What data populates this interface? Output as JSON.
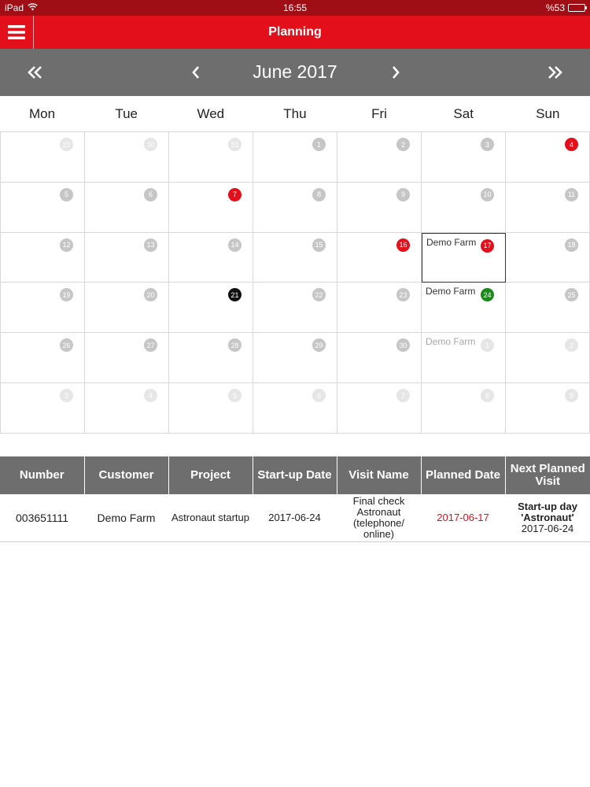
{
  "status_bar": {
    "device": "iPad",
    "time": "16:55",
    "battery": "%53",
    "battery_level": 0.53
  },
  "header": {
    "title": "Planning",
    "menu_icon": "hamburger-icon"
  },
  "calendar": {
    "month_title": "June 2017",
    "weekdays": [
      "Mon",
      "Tue",
      "Wed",
      "Thu",
      "Fri",
      "Sat",
      "Sun"
    ],
    "weeks": [
      [
        {
          "day": "29",
          "outside": true,
          "color": "grey"
        },
        {
          "day": "30",
          "outside": true,
          "color": "grey"
        },
        {
          "day": "31",
          "outside": true,
          "color": "grey"
        },
        {
          "day": "1",
          "color": "grey"
        },
        {
          "day": "2",
          "color": "grey"
        },
        {
          "day": "3",
          "color": "grey"
        },
        {
          "day": "4",
          "color": "red"
        }
      ],
      [
        {
          "day": "5",
          "color": "grey"
        },
        {
          "day": "6",
          "color": "grey"
        },
        {
          "day": "7",
          "color": "red"
        },
        {
          "day": "8",
          "color": "grey"
        },
        {
          "day": "9",
          "color": "grey"
        },
        {
          "day": "10",
          "color": "grey"
        },
        {
          "day": "11",
          "color": "grey"
        }
      ],
      [
        {
          "day": "12",
          "color": "grey"
        },
        {
          "day": "13",
          "color": "grey"
        },
        {
          "day": "14",
          "color": "grey"
        },
        {
          "day": "15",
          "color": "grey"
        },
        {
          "day": "16",
          "color": "red"
        },
        {
          "day": "17",
          "color": "red",
          "event": "Demo Farm",
          "selected": true
        },
        {
          "day": "18",
          "color": "grey"
        }
      ],
      [
        {
          "day": "19",
          "color": "grey"
        },
        {
          "day": "20",
          "color": "grey"
        },
        {
          "day": "21",
          "color": "black"
        },
        {
          "day": "22",
          "color": "grey"
        },
        {
          "day": "23",
          "color": "grey"
        },
        {
          "day": "24",
          "color": "green",
          "event": "Demo Farm"
        },
        {
          "day": "25",
          "color": "grey"
        }
      ],
      [
        {
          "day": "26",
          "color": "grey"
        },
        {
          "day": "27",
          "color": "grey"
        },
        {
          "day": "28",
          "color": "grey"
        },
        {
          "day": "29",
          "color": "grey"
        },
        {
          "day": "30",
          "color": "grey"
        },
        {
          "day": "1",
          "outside": true,
          "color": "lightgreen",
          "event": "Demo Farm",
          "faded": true
        },
        {
          "day": "2",
          "outside": true,
          "color": "grey"
        }
      ],
      [
        {
          "day": "3",
          "outside": true,
          "color": "grey"
        },
        {
          "day": "4",
          "outside": true,
          "color": "grey"
        },
        {
          "day": "5",
          "outside": true,
          "color": "grey"
        },
        {
          "day": "6",
          "outside": true,
          "color": "grey"
        },
        {
          "day": "7",
          "outside": true,
          "color": "lightgreen"
        },
        {
          "day": "8",
          "outside": true,
          "color": "grey"
        },
        {
          "day": "9",
          "outside": true,
          "color": "grey"
        }
      ]
    ]
  },
  "table": {
    "columns": [
      "Number",
      "Customer",
      "Project",
      "Start-up Date",
      "Visit Name",
      "Planned Date",
      "Next Planned Visit"
    ],
    "rows": [
      {
        "number": "003651111",
        "customer": "Demo Farm",
        "project": "Astronaut startup",
        "startup_date": "2017-06-24",
        "visit_name": "Final check Astronaut (telephone/ online)",
        "planned_date": "2017-06-17",
        "next_visit_title": "Start-up day 'Astronaut'",
        "next_visit_date": "2017-06-24"
      }
    ]
  },
  "colors": {
    "brand_red": "#e30f1b",
    "status_bar": "#9e0e14",
    "nav_grey": "#6e6e6e",
    "badge_grey": "#c6c6c6",
    "badge_green": "#1a8a1a",
    "badge_black": "#111111"
  }
}
